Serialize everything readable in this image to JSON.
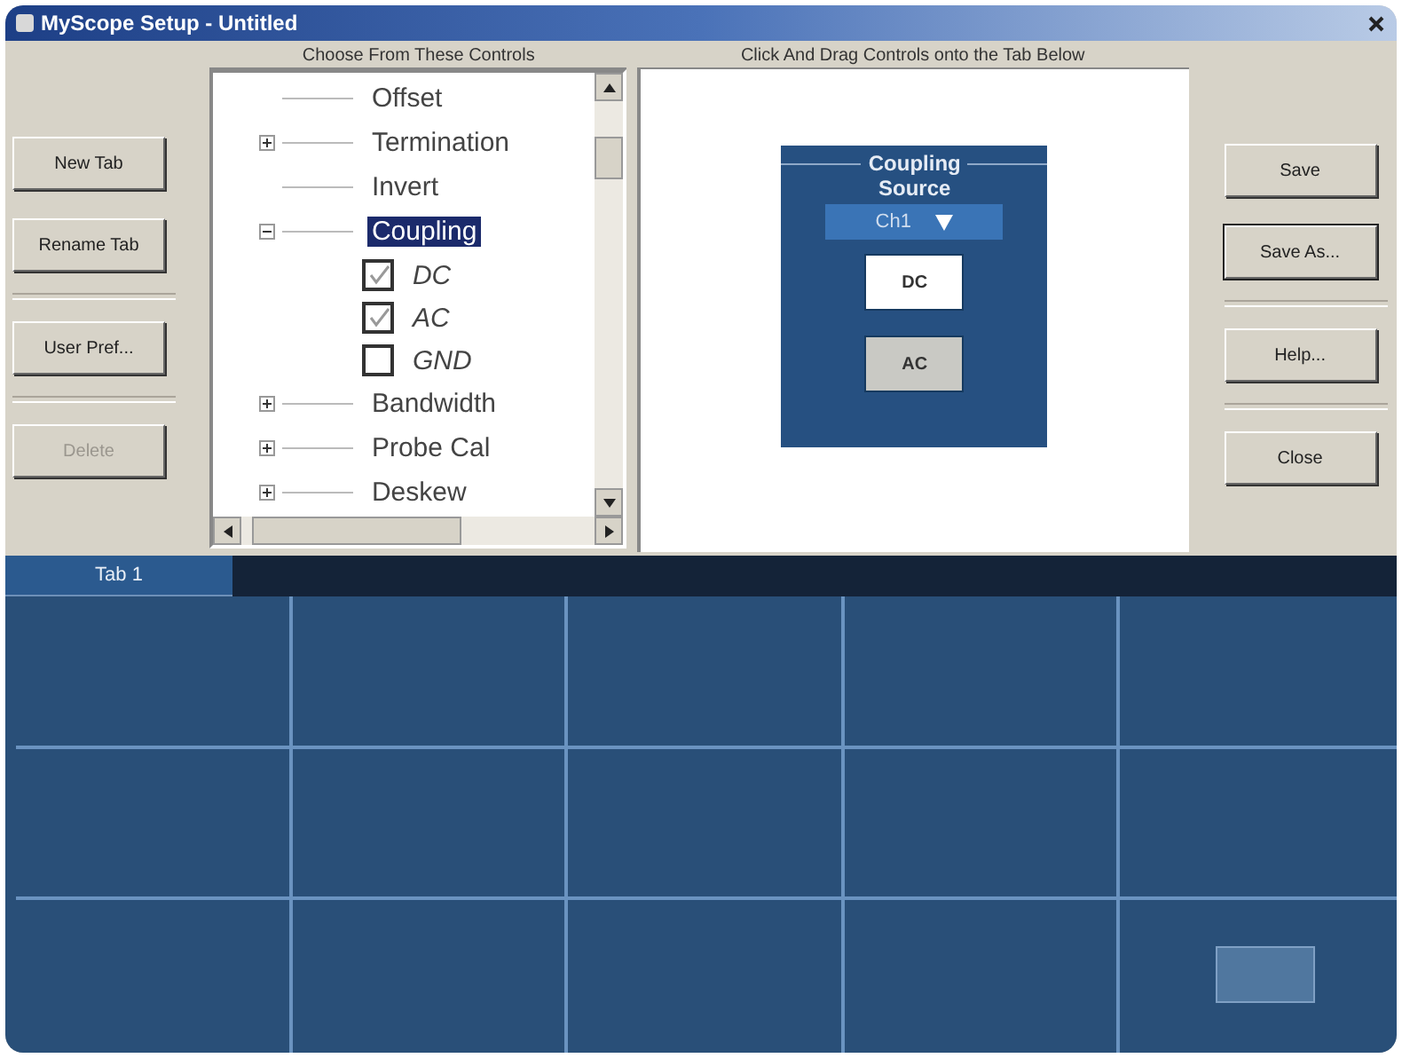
{
  "window": {
    "title": "MyScope Setup - Untitled"
  },
  "left_button_groups": [
    [
      {
        "label": "New Tab",
        "disabled": false
      },
      {
        "label": "Rename Tab",
        "disabled": false
      }
    ],
    [
      {
        "label": "User Pref...",
        "disabled": false
      }
    ],
    [
      {
        "label": "Delete",
        "disabled": true
      }
    ]
  ],
  "controls_panel": {
    "heading": "Choose From These Controls",
    "tree": [
      {
        "label": "Offset",
        "kind": "leaf",
        "selected": false
      },
      {
        "label": "Termination",
        "kind": "group",
        "expanded": false,
        "selected": false
      },
      {
        "label": "Invert",
        "kind": "leaf",
        "selected": false
      },
      {
        "label": "Coupling",
        "kind": "group",
        "expanded": true,
        "selected": true,
        "children": [
          {
            "label": "DC",
            "kind": "check",
            "checked": true
          },
          {
            "label": "AC",
            "kind": "check",
            "checked": true
          },
          {
            "label": "GND",
            "kind": "check",
            "checked": false
          }
        ]
      },
      {
        "label": "Bandwidth",
        "kind": "group",
        "expanded": false,
        "selected": false
      },
      {
        "label": "Probe Cal",
        "kind": "group",
        "expanded": false,
        "selected": false
      },
      {
        "label": "Deskew",
        "kind": "group",
        "expanded": false,
        "selected": false
      }
    ]
  },
  "preview_panel": {
    "heading": "Click And Drag Controls onto the Tab Below",
    "control": {
      "title": "Coupling",
      "source_label": "Source",
      "source_value": "Ch1",
      "options": [
        {
          "label": "DC",
          "selected": true
        },
        {
          "label": "AC",
          "selected": false
        }
      ]
    }
  },
  "right_button_groups": [
    [
      {
        "label": "Save",
        "default": false
      },
      {
        "label": "Save As...",
        "default": true
      }
    ],
    [
      {
        "label": "Help...",
        "default": false
      }
    ],
    [
      {
        "label": "Close",
        "default": false
      }
    ]
  ],
  "tabs": [
    {
      "label": "Tab 1",
      "selected": true
    }
  ],
  "tab_area": {
    "button_disabled": true
  }
}
